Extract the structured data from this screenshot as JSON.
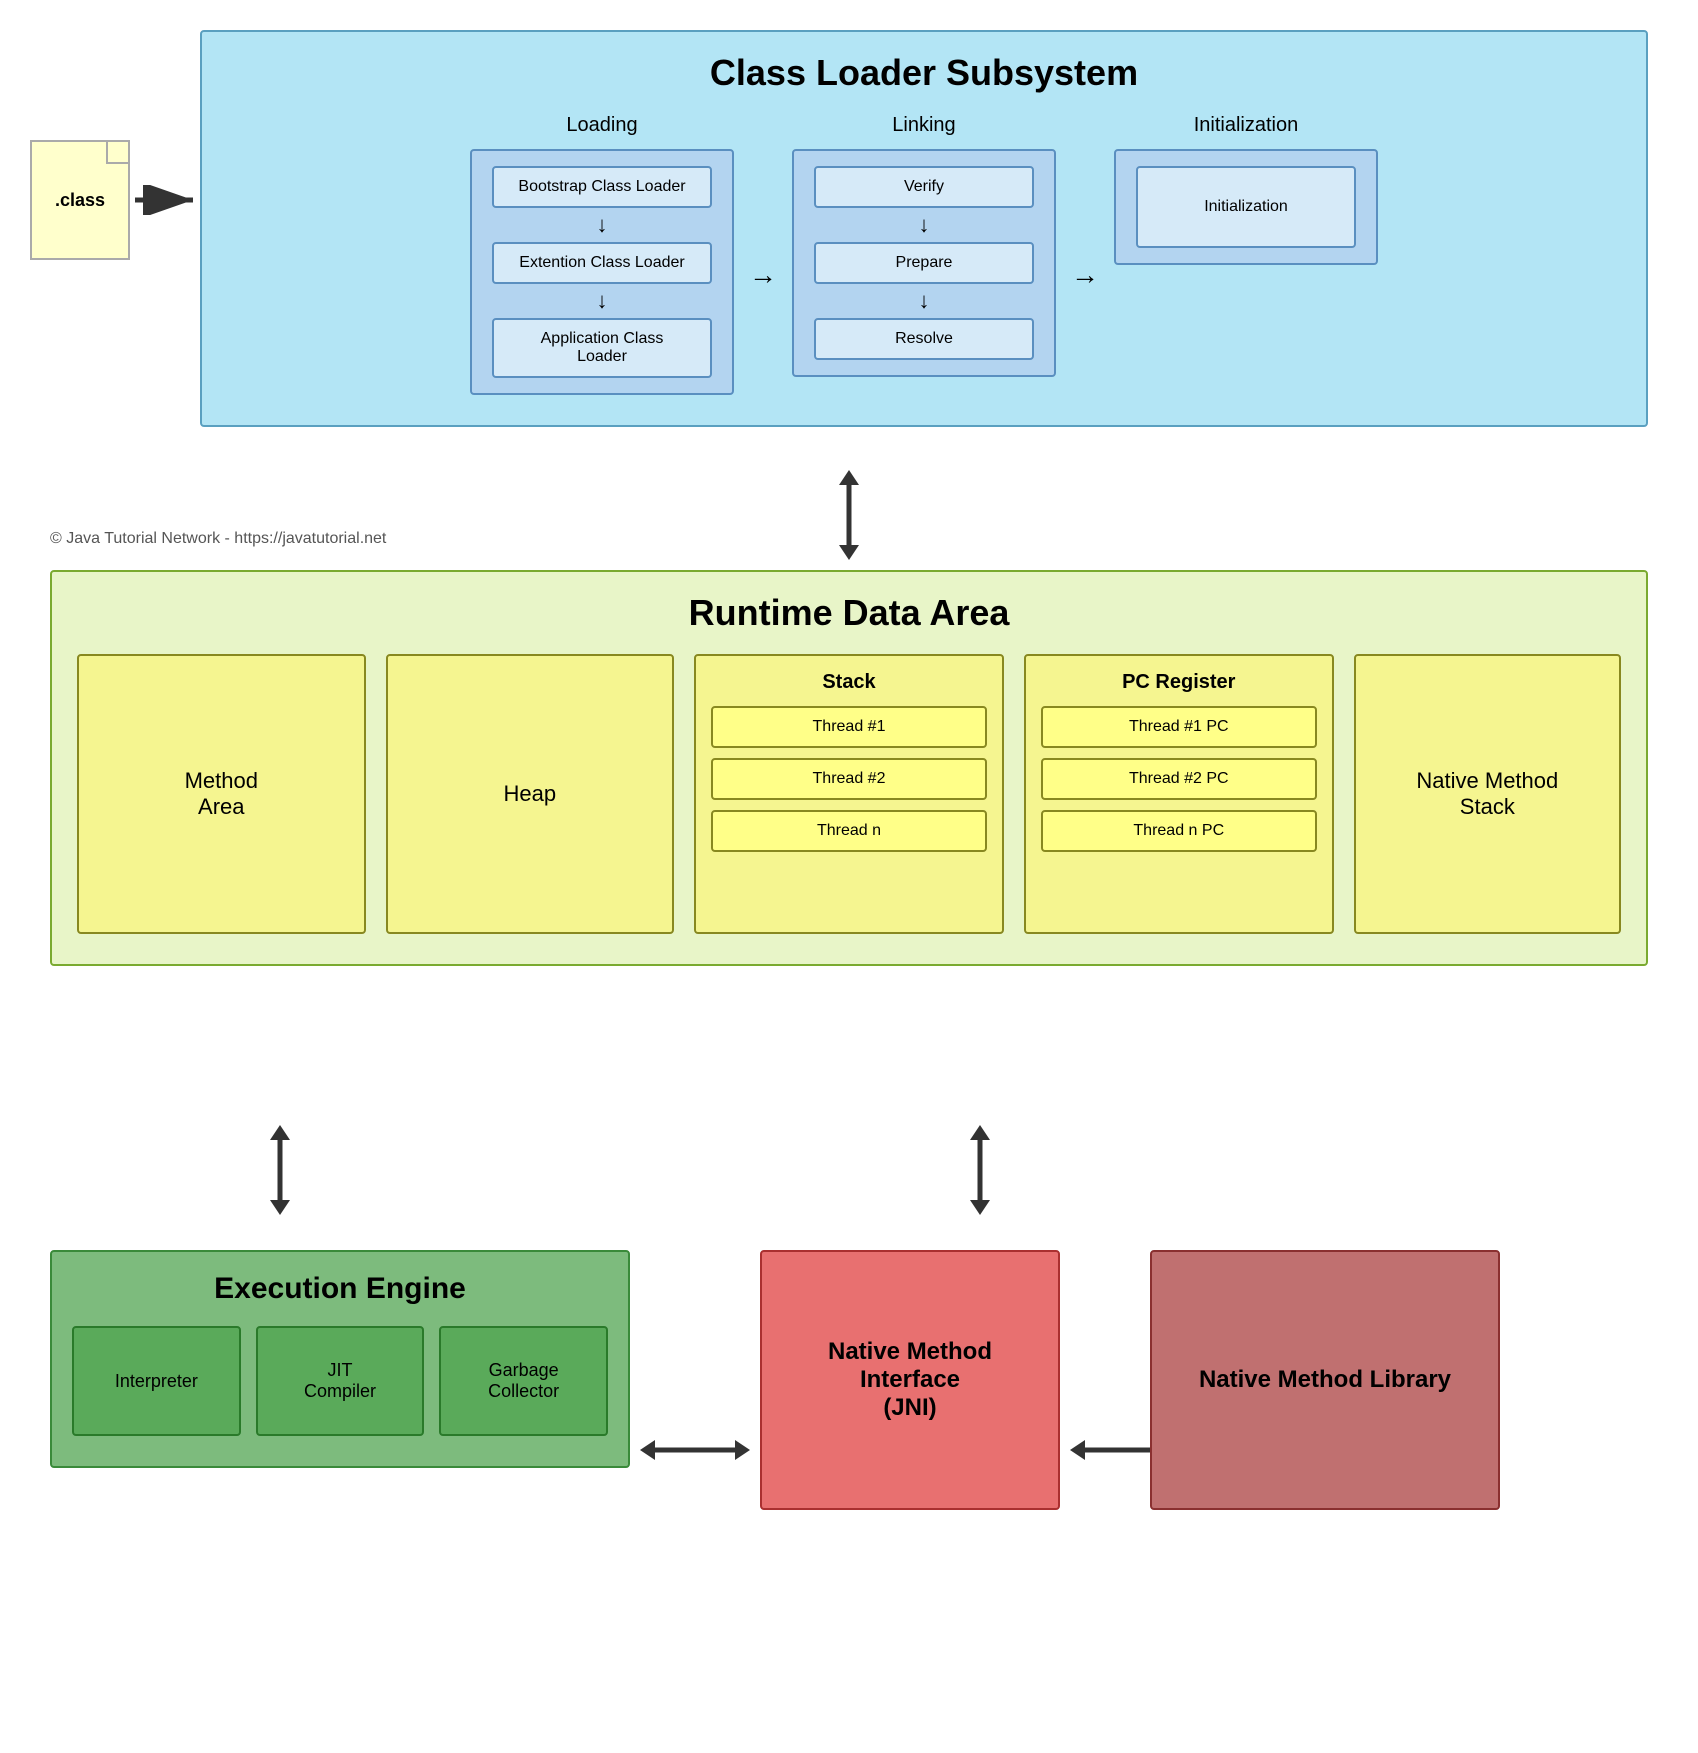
{
  "class_loader": {
    "title": "Class Loader Subsystem",
    "loading_label": "Loading",
    "linking_label": "Linking",
    "initialization_label": "Initialization",
    "loading_boxes": [
      "Bootstrap Class Loader",
      "Extention Class Loader",
      "Application Class Loader"
    ],
    "linking_boxes": [
      "Verify",
      "Prepare",
      "Resolve"
    ],
    "init_box": "Initialization"
  },
  "class_file": {
    "label": ".class"
  },
  "runtime": {
    "title": "Runtime Data Area",
    "method_area": "Method\nArea",
    "heap": "Heap",
    "stack_label": "Stack",
    "stack_threads": [
      "Thread #1",
      "Thread #2",
      "Thread n"
    ],
    "pc_label": "PC Register",
    "pc_threads": [
      "Thread #1 PC",
      "Thread #2 PC",
      "Thread n PC"
    ],
    "native_method_stack": "Native Method\nStack"
  },
  "execution_engine": {
    "title": "Execution Engine",
    "boxes": [
      "Interpreter",
      "JIT\nCompiler",
      "Garbage\nCollector"
    ]
  },
  "nmi": {
    "label": "Native Method\nInterface\n(JNI)"
  },
  "nml": {
    "label": "Native Method\nLibrary"
  },
  "copyright": "© Java Tutorial Network - https://javatutorial.net"
}
